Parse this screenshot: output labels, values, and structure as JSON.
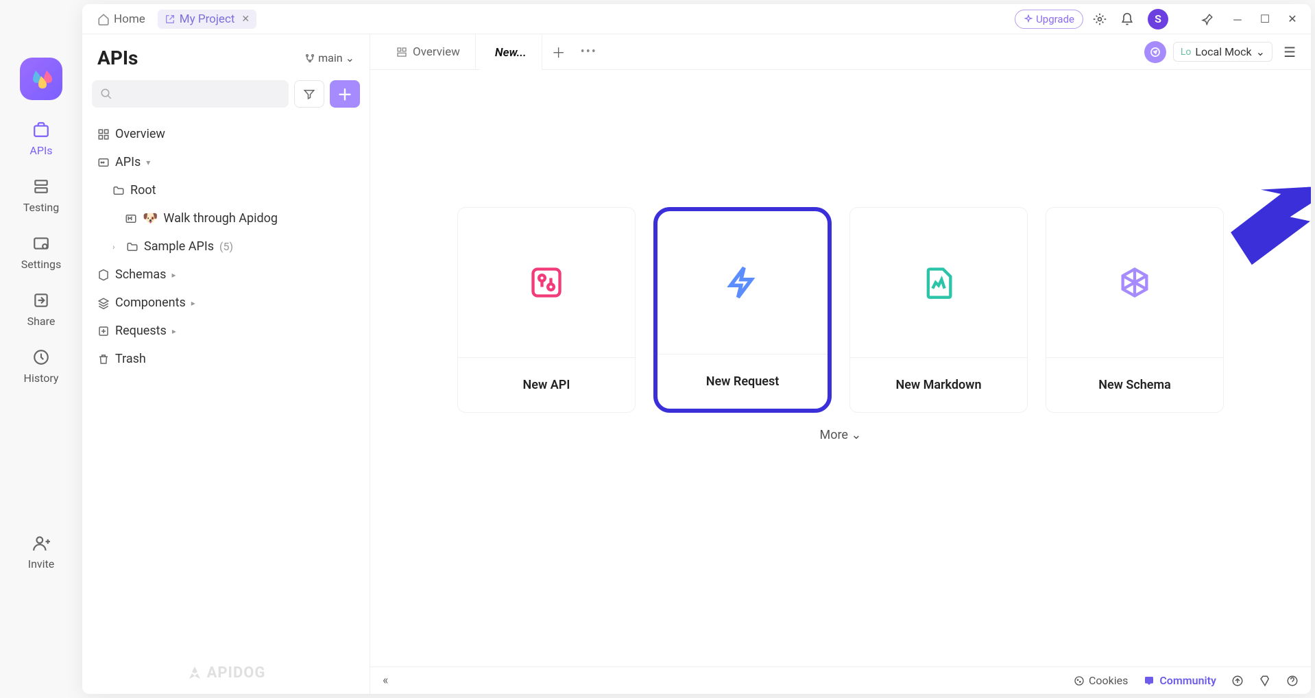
{
  "titlebar": {
    "home_label": "Home",
    "project_tab_label": "My Project",
    "upgrade_label": "Upgrade",
    "avatar_initial": "S"
  },
  "left_rail": {
    "items": [
      {
        "label": "APIs"
      },
      {
        "label": "Testing"
      },
      {
        "label": "Settings"
      },
      {
        "label": "Share"
      },
      {
        "label": "History"
      },
      {
        "label": "Invite"
      }
    ]
  },
  "sidebar": {
    "title": "APIs",
    "branch_label": "main",
    "tree": {
      "overview_label": "Overview",
      "apis_label": "APIs",
      "root_label": "Root",
      "walkthrough_label": "Walk through Apidog",
      "sample_apis_label": "Sample APIs",
      "sample_apis_count": "(5)",
      "schemas_label": "Schemas",
      "components_label": "Components",
      "requests_label": "Requests",
      "trash_label": "Trash"
    },
    "footer_brand": "APIDOG"
  },
  "tabs": {
    "overview_label": "Overview",
    "new_label": "New...",
    "env_prefix": "Lo",
    "env_label": "Local Mock"
  },
  "canvas": {
    "cards": [
      {
        "label": "New API"
      },
      {
        "label": "New Request"
      },
      {
        "label": "New Markdown"
      },
      {
        "label": "New Schema"
      }
    ],
    "more_label": "More"
  },
  "footer": {
    "cookies_label": "Cookies",
    "community_label": "Community"
  }
}
